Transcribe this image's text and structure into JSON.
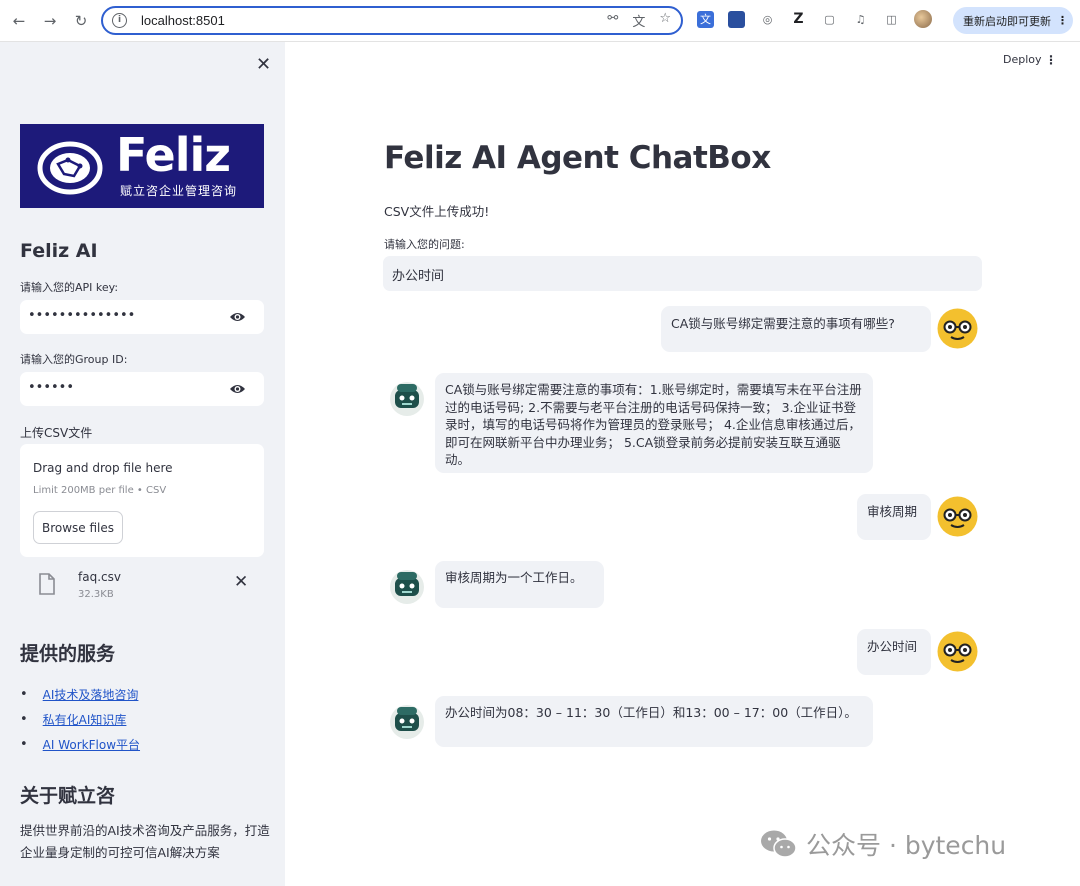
{
  "browser": {
    "url": "localhost:8501",
    "update_button": "重新启动即可更新"
  },
  "sidebar": {
    "logo": {
      "word": "Feliz",
      "subtitle": "赋立咨企业管理咨询"
    },
    "title": "Feliz AI",
    "api_key": {
      "label": "请输入您的API key:",
      "value": "••••••••••••••"
    },
    "group_id": {
      "label": "请输入您的Group ID:",
      "value": "••••••"
    },
    "upload": {
      "label": "上传CSV文件",
      "drag_text": "Drag and drop file here",
      "limit_text": "Limit 200MB per file • CSV",
      "browse_label": "Browse files",
      "file_name": "faq.csv",
      "file_size": "32.3KB"
    },
    "services_title": "提供的服务",
    "services": [
      "AI技术及落地咨询",
      "私有化AI知识库",
      "AI WorkFlow平台"
    ],
    "about_title": "关于赋立咨",
    "about_text": "提供世界前沿的AI技术咨询及产品服务，打造企业量身定制的可控可信AI解决方案"
  },
  "main": {
    "deploy_label": "Deploy",
    "title": "Feliz AI Agent ChatBox",
    "upload_status": "CSV文件上传成功!",
    "question_label": "请输入您的问题:",
    "question_value": "办公时间",
    "messages": [
      {
        "role": "user",
        "text": "CA锁与账号绑定需要注意的事项有哪些?"
      },
      {
        "role": "assistant",
        "text": "CA锁与账号绑定需要注意的事项有：1.账号绑定时，需要填写未在平台注册过的电话号码; 2.不需要与老平台注册的电话号码保持一致； 3.企业证书登录时，填写的电话号码将作为管理员的登录账号； 4.企业信息审核通过后，即可在网联新平台中办理业务； 5.CA锁登录前务必提前安装互联互通驱动。"
      },
      {
        "role": "user",
        "text": "审核周期"
      },
      {
        "role": "assistant",
        "text": "审核周期为一个工作日。"
      },
      {
        "role": "user",
        "text": "办公时间"
      },
      {
        "role": "assistant",
        "text": "办公时间为08：30 – 11：30（工作日）和13：00 – 17：00（工作日）。"
      }
    ]
  },
  "watermark": {
    "text": "公众号 · bytechu"
  },
  "colors": {
    "sidebar_bg": "#f0f2f6",
    "link": "#2054c8",
    "logo_bg": "#1d1a7a",
    "user_avatar": "#f3c02e",
    "bot_avatar": "#1e4f4a"
  }
}
